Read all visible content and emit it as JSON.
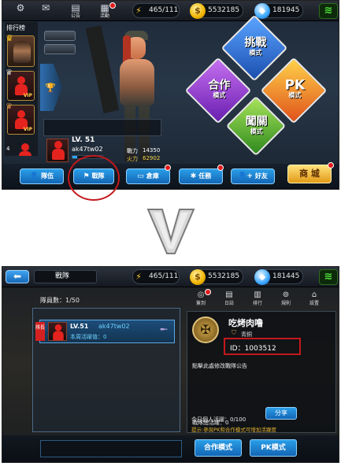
{
  "screen1": {
    "top_icons": [
      "公告",
      "活動"
    ],
    "stamina": "465/111",
    "coins": "5532185",
    "gems": "181945",
    "leaderboard_title": "排行榜",
    "rank_number": "4",
    "player": {
      "level": "LV. 51",
      "name": "ak47tw02"
    },
    "stats": {
      "power_label": "戰力",
      "power": "14350",
      "fire_label": "火力",
      "fire": "62902"
    },
    "modes": [
      {
        "title": "挑戰",
        "sub": "模式"
      },
      {
        "title": "合作",
        "sub": "模式"
      },
      {
        "title": "PK",
        "sub": "模式"
      },
      {
        "title": "闖關",
        "sub": "模式"
      }
    ],
    "nav": [
      "隊伍",
      "戰隊",
      "倉庫",
      "任務",
      "好友"
    ],
    "shop": "商 城",
    "vip": "VIP"
  },
  "arrow": "V",
  "screen2": {
    "title": "戰隊",
    "stamina": "465/111",
    "coins": "5532185",
    "gems": "181445",
    "tools": [
      "簽到",
      "日誌",
      "排行",
      "規則",
      "設置"
    ],
    "member_count": "隊員數：1/50",
    "member": {
      "role": "隊長",
      "level": "LV.51",
      "name": "ak47tw02",
      "weekly": "本周活躍值：0"
    },
    "team": {
      "name": "吃烤肉噜",
      "rank": "青銅",
      "id": "ID：1003512"
    },
    "notice": "點擊此處修改戰隊公告",
    "total_label": "戰隊總活躍：0",
    "today_label": "今日個人活躍：0/100",
    "share": "分享",
    "tip": "提示:參與PK和合作模式可增加活躍度",
    "buttons": [
      "合作模式",
      "PK模式"
    ]
  },
  "colors": {
    "accent_blue": "#1f8ce0",
    "highlight_red": "#c4181c",
    "gold": "#f1b400"
  }
}
